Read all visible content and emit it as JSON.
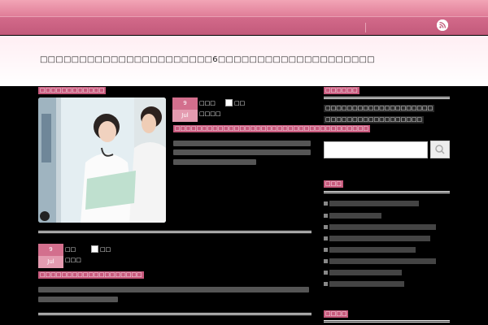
{
  "header": {
    "site_title": "□□□□□□□□□□□□□□□□□□□□□□6□□□□□□□□□□□□□□□□□□□□",
    "rss_icon": "rss-icon"
  },
  "main": {
    "section_title": "□□□□□□□□□□□□",
    "posts": [
      {
        "day": "9",
        "month": "Jul",
        "meta_author": "□□□",
        "meta_comments": "□□",
        "meta_category": "□□□□",
        "title": "□□□□□□□□□□□□□□□□□□□□□□□□□□□□□□□□□□□□"
      },
      {
        "day": "9",
        "month": "Jul",
        "meta_author": "□□",
        "meta_comments": "□□",
        "meta_category": "□□□",
        "title": "□□□□□□□□□□□□□□□□□□□"
      }
    ]
  },
  "sidebar": {
    "widget1_title": "□□□□□□",
    "widget1_line1": "□□□□□□□□□□□□□□□□□□□□",
    "widget1_line2": "□□□□□□□□□□□□□□□□□□",
    "search_icon": "search-icon",
    "widget2_title": "□□□",
    "widget3_title": "□□□□"
  },
  "colors": {
    "accent": "#c7597c",
    "nav": "#c25a7b",
    "background": "#000000"
  }
}
